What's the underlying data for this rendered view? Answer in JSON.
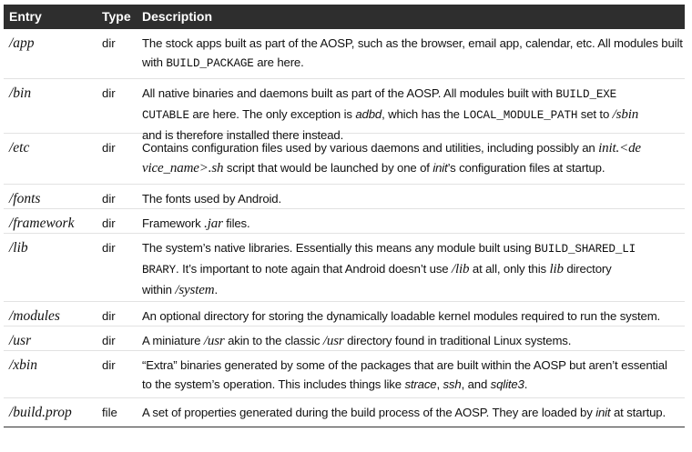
{
  "header": {
    "entry": "Entry",
    "type": "Type",
    "description": "Description"
  },
  "rows": [
    {
      "entry": "/app",
      "type": "dir",
      "lines": [
        [
          {
            "t": "The stock apps built as part of the AOSP, such as the browser, email app, calendar, etc. All modules built"
          }
        ],
        [
          {
            "t": "with "
          },
          {
            "t": "BUILD_PACKAGE",
            "s": "mono"
          },
          {
            "t": " are here."
          }
        ]
      ]
    },
    {
      "entry": "/bin",
      "type": "dir",
      "lines": [
        [
          {
            "t": "All native binaries and daemons built as part of the AOSP. All modules built with "
          },
          {
            "t": "BUILD_EXE",
            "s": "mono"
          }
        ],
        [
          {
            "t": "CUTABLE",
            "s": "mono"
          },
          {
            "t": " are here. The only exception is "
          },
          {
            "t": "adbd",
            "s": "it"
          },
          {
            "t": ", which has the "
          },
          {
            "t": "LOCAL_MODULE_PATH",
            "s": "mono"
          },
          {
            "t": " set to "
          },
          {
            "t": "/sbin",
            "s": "serif-it"
          }
        ],
        [
          {
            "t": "and is therefore installed there instead."
          }
        ]
      ]
    },
    {
      "entry": "/etc",
      "type": "dir",
      "lines": [
        [
          {
            "t": "Contains configuration files used by various daemons and utilities, including possibly an "
          },
          {
            "t": "init.<de",
            "s": "serif-it"
          }
        ],
        [
          {
            "t": "vice_name>.sh",
            "s": "serif-it"
          },
          {
            "t": " script that would be launched by one of "
          },
          {
            "t": "init",
            "s": "it"
          },
          {
            "t": "’s configuration files at startup."
          }
        ]
      ]
    },
    {
      "entry": "/fonts",
      "type": "dir",
      "lines": [
        [
          {
            "t": "The fonts used by Android."
          }
        ]
      ]
    },
    {
      "entry": "/framework",
      "type": "dir",
      "lines": [
        [
          {
            "t": "Framework "
          },
          {
            "t": ".jar",
            "s": "serif-it"
          },
          {
            "t": " files."
          }
        ]
      ]
    },
    {
      "entry": "/lib",
      "type": "dir",
      "lines": [
        [
          {
            "t": "The system’s native libraries. Essentially this means any module built using "
          },
          {
            "t": "BUILD_SHARED_LI",
            "s": "mono"
          }
        ],
        [
          {
            "t": "BRARY",
            "s": "mono"
          },
          {
            "t": ". It’s important to note again that Android doesn’t use "
          },
          {
            "t": "/lib",
            "s": "serif-it"
          },
          {
            "t": " at all, only this "
          },
          {
            "t": "lib",
            "s": "serif-it"
          },
          {
            "t": " directory"
          }
        ],
        [
          {
            "t": "within "
          },
          {
            "t": "/system",
            "s": "serif-it"
          },
          {
            "t": "."
          }
        ]
      ]
    },
    {
      "entry": "/modules",
      "type": "dir",
      "lines": [
        [
          {
            "t": "An optional directory for storing the dynamically loadable kernel modules required to run the system."
          }
        ]
      ]
    },
    {
      "entry": "/usr",
      "type": "dir",
      "lines": [
        [
          {
            "t": "A miniature "
          },
          {
            "t": "/usr",
            "s": "serif-it"
          },
          {
            "t": " akin to the classic "
          },
          {
            "t": "/usr",
            "s": "serif-it"
          },
          {
            "t": " directory found in traditional Linux systems."
          }
        ]
      ]
    },
    {
      "entry": "/xbin",
      "type": "dir",
      "lines": [
        [
          {
            "t": "“Extra” binaries generated by some of the packages that are built within the AOSP but aren’t essential"
          }
        ],
        [
          {
            "t": "to the system’s operation. This includes things like "
          },
          {
            "t": "strace",
            "s": "it"
          },
          {
            "t": ", "
          },
          {
            "t": "ssh",
            "s": "it"
          },
          {
            "t": ", and "
          },
          {
            "t": "sqlite3",
            "s": "it"
          },
          {
            "t": "."
          }
        ]
      ]
    },
    {
      "entry": "/build.prop",
      "type": "file",
      "lines": [
        [
          {
            "t": "A set of properties generated during the build process of the AOSP. They are loaded by "
          },
          {
            "t": "init",
            "s": "it"
          },
          {
            "t": " at startup."
          }
        ]
      ]
    }
  ]
}
